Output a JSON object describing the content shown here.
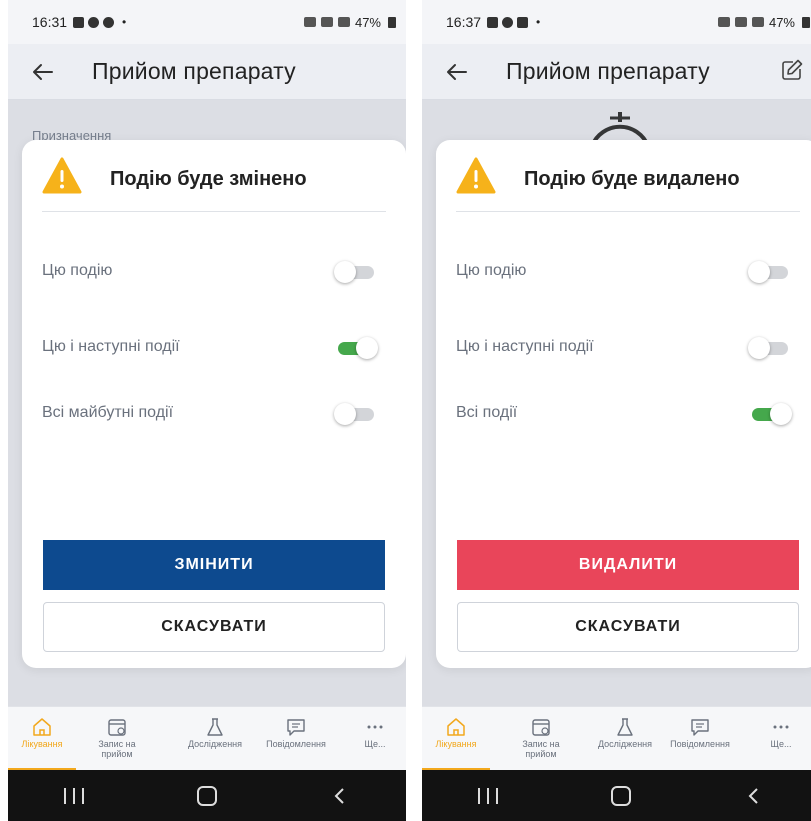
{
  "colors": {
    "accent": "#f2a81d",
    "toggle_on": "#45a84c",
    "change_button": "#0d4a8f",
    "delete_button": "#e9455a",
    "warning": "#f6b21a"
  },
  "left": {
    "status": {
      "time": "16:31",
      "battery": "47%"
    },
    "header": {
      "title": "Прийом препарату"
    },
    "background_label": "Призначення",
    "dialog": {
      "title": "Подію буде змінено",
      "options": [
        {
          "label": "Цю подію",
          "on": false
        },
        {
          "label": "Цю і наступні події",
          "on": true
        },
        {
          "label": "Всі майбутні події",
          "on": false
        }
      ],
      "primary_label": "ЗМІНИТИ",
      "secondary_label": "СКАСУВАТИ"
    },
    "nav": [
      {
        "label": "Лікування",
        "icon": "home-icon",
        "active": true
      },
      {
        "label": "Запис на прийом",
        "icon": "calendar-icon",
        "active": false
      },
      {
        "label": "Дослідження",
        "icon": "flask-icon",
        "active": false
      },
      {
        "label": "Повідомлення",
        "icon": "message-icon",
        "active": false
      },
      {
        "label": "Ще...",
        "icon": "more-icon",
        "active": false
      }
    ]
  },
  "right": {
    "status": {
      "time": "16:37",
      "battery": "47%"
    },
    "header": {
      "title": "Прийом препарату"
    },
    "dialog": {
      "title": "Подію буде видалено",
      "options": [
        {
          "label": "Цю подію",
          "on": false
        },
        {
          "label": "Цю і наступні події",
          "on": false
        },
        {
          "label": "Всі події",
          "on": true
        }
      ],
      "primary_label": "ВИДАЛИТИ",
      "secondary_label": "СКАСУВАТИ"
    },
    "nav": [
      {
        "label": "Лікування",
        "icon": "home-icon",
        "active": true
      },
      {
        "label": "Запис на прийом",
        "icon": "calendar-icon",
        "active": false
      },
      {
        "label": "Дослідження",
        "icon": "flask-icon",
        "active": false
      },
      {
        "label": "Повідомлення",
        "icon": "message-icon",
        "active": false
      },
      {
        "label": "Ще...",
        "icon": "more-icon",
        "active": false
      }
    ]
  }
}
